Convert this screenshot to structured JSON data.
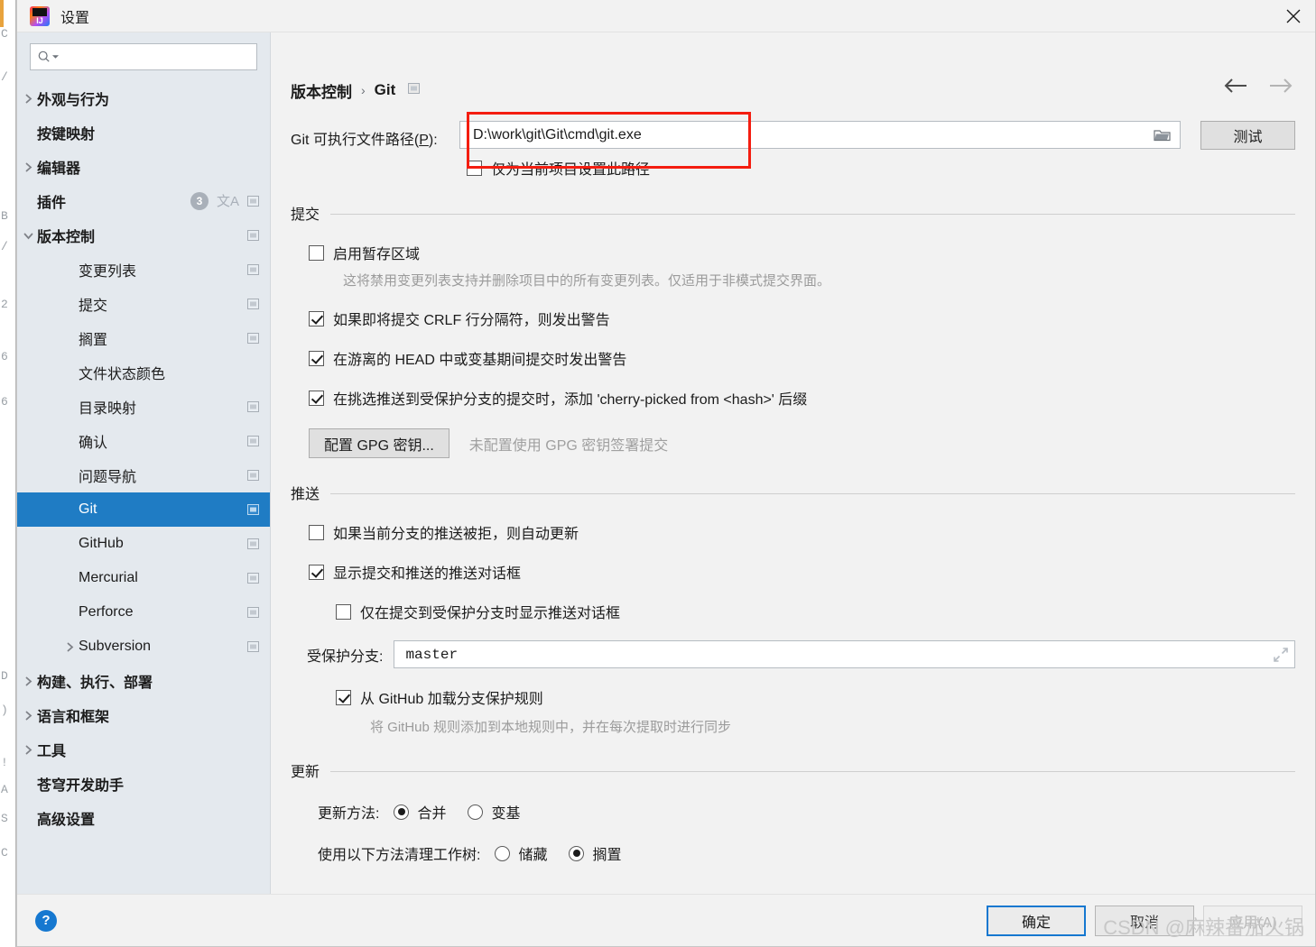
{
  "window": {
    "title": "设置",
    "logo_icon": "intellij-idea-logo",
    "close_icon": "close-icon"
  },
  "sidebar": {
    "search": {
      "placeholder": "",
      "value": "",
      "icon": "search-icon",
      "dropdown_icon": "chevron-down-icon"
    },
    "items": [
      {
        "label": "外观与行为",
        "level": 0,
        "bold": true,
        "arrow": "right",
        "selected": false,
        "badge": null,
        "lang_icon": false,
        "window_icon": false
      },
      {
        "label": "按键映射",
        "level": 0,
        "bold": true,
        "arrow": null,
        "selected": false,
        "badge": null,
        "lang_icon": false,
        "window_icon": false
      },
      {
        "label": "编辑器",
        "level": 0,
        "bold": true,
        "arrow": "right",
        "selected": false,
        "badge": null,
        "lang_icon": false,
        "window_icon": false
      },
      {
        "label": "插件",
        "level": 0,
        "bold": true,
        "arrow": null,
        "selected": false,
        "badge": "3",
        "lang_icon": true,
        "window_icon": true
      },
      {
        "label": "版本控制",
        "level": 0,
        "bold": true,
        "arrow": "down",
        "selected": false,
        "badge": null,
        "lang_icon": false,
        "window_icon": true
      },
      {
        "label": "变更列表",
        "level": 1,
        "bold": false,
        "arrow": null,
        "selected": false,
        "badge": null,
        "lang_icon": false,
        "window_icon": true
      },
      {
        "label": "提交",
        "level": 1,
        "bold": false,
        "arrow": null,
        "selected": false,
        "badge": null,
        "lang_icon": false,
        "window_icon": true
      },
      {
        "label": "搁置",
        "level": 1,
        "bold": false,
        "arrow": null,
        "selected": false,
        "badge": null,
        "lang_icon": false,
        "window_icon": true
      },
      {
        "label": "文件状态颜色",
        "level": 1,
        "bold": false,
        "arrow": null,
        "selected": false,
        "badge": null,
        "lang_icon": false,
        "window_icon": false
      },
      {
        "label": "目录映射",
        "level": 1,
        "bold": false,
        "arrow": null,
        "selected": false,
        "badge": null,
        "lang_icon": false,
        "window_icon": true
      },
      {
        "label": "确认",
        "level": 1,
        "bold": false,
        "arrow": null,
        "selected": false,
        "badge": null,
        "lang_icon": false,
        "window_icon": true
      },
      {
        "label": "问题导航",
        "level": 1,
        "bold": false,
        "arrow": null,
        "selected": false,
        "badge": null,
        "lang_icon": false,
        "window_icon": true
      },
      {
        "label": "Git",
        "level": 1,
        "bold": false,
        "arrow": null,
        "selected": true,
        "badge": null,
        "lang_icon": false,
        "window_icon": true
      },
      {
        "label": "GitHub",
        "level": 1,
        "bold": false,
        "arrow": null,
        "selected": false,
        "badge": null,
        "lang_icon": false,
        "window_icon": true
      },
      {
        "label": "Mercurial",
        "level": 1,
        "bold": false,
        "arrow": null,
        "selected": false,
        "badge": null,
        "lang_icon": false,
        "window_icon": true
      },
      {
        "label": "Perforce",
        "level": 1,
        "bold": false,
        "arrow": null,
        "selected": false,
        "badge": null,
        "lang_icon": false,
        "window_icon": true
      },
      {
        "label": "Subversion",
        "level": 1,
        "bold": false,
        "arrow": "right",
        "selected": false,
        "badge": null,
        "lang_icon": false,
        "window_icon": true
      },
      {
        "label": "构建、执行、部署",
        "level": 0,
        "bold": true,
        "arrow": "right",
        "selected": false,
        "badge": null,
        "lang_icon": false,
        "window_icon": false
      },
      {
        "label": "语言和框架",
        "level": 0,
        "bold": true,
        "arrow": "right",
        "selected": false,
        "badge": null,
        "lang_icon": false,
        "window_icon": false
      },
      {
        "label": "工具",
        "level": 0,
        "bold": true,
        "arrow": "right",
        "selected": false,
        "badge": null,
        "lang_icon": false,
        "window_icon": false
      },
      {
        "label": "苍穹开发助手",
        "level": 0,
        "bold": true,
        "arrow": null,
        "selected": false,
        "badge": null,
        "lang_icon": false,
        "window_icon": false
      },
      {
        "label": "高级设置",
        "level": 0,
        "bold": true,
        "arrow": null,
        "selected": false,
        "badge": null,
        "lang_icon": false,
        "window_icon": false
      }
    ]
  },
  "main": {
    "breadcrumb": {
      "parent": "版本控制",
      "separator": "›",
      "current": "Git",
      "window_icon": "window-restore-icon"
    },
    "nav": {
      "back_icon": "arrow-left-icon",
      "forward_icon": "arrow-right-icon"
    },
    "git_path": {
      "label_prefix": "Git 可执行文件路径(",
      "label_mnemonic": "P",
      "label_suffix": "):",
      "value": "D:\\work\\git\\Git\\cmd\\git.exe",
      "placeholder": "",
      "browse_icon": "folder-icon",
      "project_only_label": "仅为当前项目设置此路径",
      "project_only_checked": false,
      "test_button": "测试",
      "highlight_color": "#f41d10"
    },
    "commit_section": {
      "title": "提交",
      "staging_label": "启用暂存区域",
      "staging_checked": false,
      "staging_hint": "这将禁用变更列表支持并删除项目中的所有变更列表。仅适用于非模式提交界面。",
      "crlf_label": "如果即将提交 CRLF 行分隔符，则发出警告",
      "crlf_checked": true,
      "detached_label": "在游离的 HEAD 中或变基期间提交时发出警告",
      "detached_checked": true,
      "cherry_label": "在挑选推送到受保护分支的提交时，添加 'cherry-picked from <hash>' 后缀",
      "cherry_checked": true,
      "gpg_button": "配置 GPG 密钥...",
      "gpg_note": "未配置使用 GPG 密钥签署提交"
    },
    "push_section": {
      "title": "推送",
      "auto_update_label": "如果当前分支的推送被拒，则自动更新",
      "auto_update_checked": false,
      "show_dialog_label": "显示提交和推送的推送对话框",
      "show_dialog_checked": true,
      "protected_only_label": "仅在提交到受保护分支时显示推送对话框",
      "protected_only_checked": false,
      "protected_branches_label": "受保护分支:",
      "protected_branches_value": "master",
      "expand_icon": "expand-icon",
      "github_rules_label": "从 GitHub 加载分支保护规则",
      "github_rules_checked": true,
      "github_rules_hint": "将 GitHub 规则添加到本地规则中，并在每次提取时进行同步"
    },
    "update_section": {
      "title": "更新",
      "method_label": "更新方法:",
      "method_options": [
        {
          "label": "合并",
          "selected": true
        },
        {
          "label": "变基",
          "selected": false
        }
      ],
      "clean_label": "使用以下方法清理工作树:",
      "clean_options": [
        {
          "label": "储藏",
          "selected": false
        },
        {
          "label": "搁置",
          "selected": true
        }
      ]
    }
  },
  "footer": {
    "help_icon": "help-icon",
    "help_glyph": "?",
    "ok_button": "确定",
    "cancel_button": "取消",
    "apply_button": "应用(A)"
  },
  "watermark": "CSDN @麻辣番茄火锅",
  "background_editor": {
    "fragments": [
      "C",
      "/",
      "B",
      "/",
      "2",
      "6",
      "6",
      "D",
      ")",
      "/",
      "!",
      "A",
      "S",
      "C"
    ]
  },
  "colors": {
    "selection_blue": "#1f7cc4",
    "sidebar_bg": "#e4e9ee",
    "panel_bg": "#f2f2f2",
    "accent_highlight": "#f41d10",
    "help_blue": "#1678d0"
  }
}
